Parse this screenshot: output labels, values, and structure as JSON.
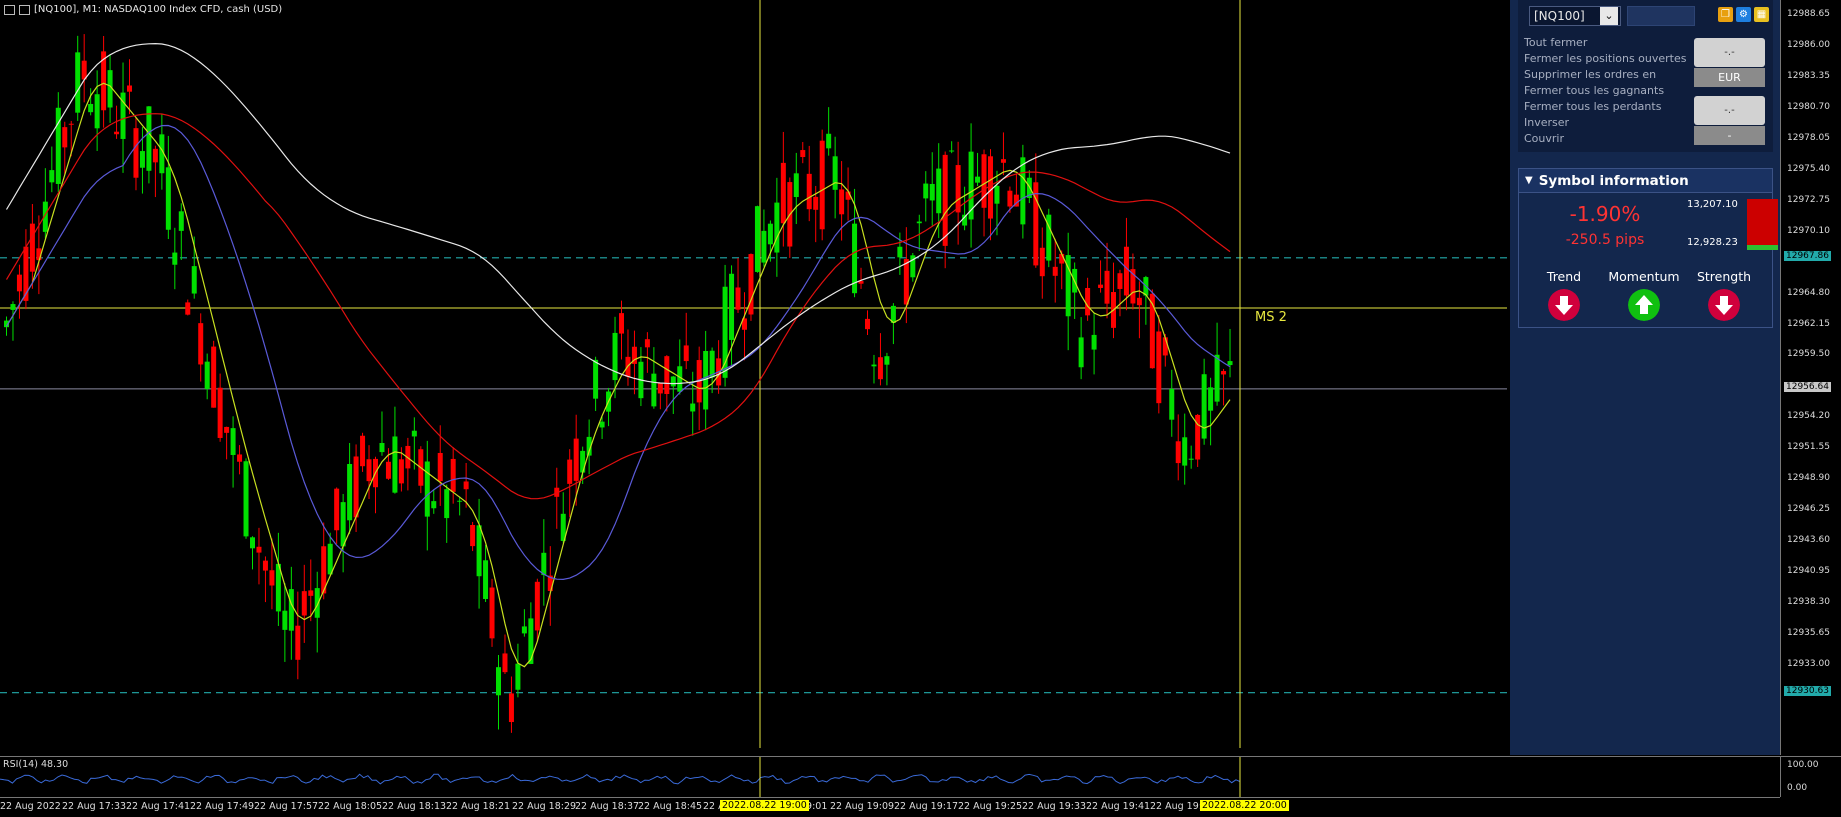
{
  "window": {
    "title": "[NQ100], M1:  NASDAQ100 Index CFD, cash (USD)"
  },
  "chart": {
    "ms_label": "MS 2",
    "price_labels": [
      "12988.65",
      "12986.00",
      "12983.35",
      "12980.70",
      "12978.05",
      "12975.40",
      "12972.75",
      "12970.10",
      "12964.80",
      "12962.15",
      "12959.50",
      "12954.20",
      "12951.55",
      "12948.90",
      "12946.25",
      "12943.60",
      "12940.95",
      "12938.30",
      "12935.65",
      "12933.00"
    ],
    "price_tags": {
      "upper_dash": "12967.86",
      "current": "12956.64",
      "lower_dash": "12930.63"
    },
    "time_labels": [
      "22 Aug 2022",
      "22 Aug 17:33",
      "22 Aug 17:41",
      "22 Aug 17:49",
      "22 Aug 17:57",
      "22 Aug 18:05",
      "22 Aug 18:13",
      "22 Aug 18:21",
      "22 Aug 18:29",
      "22 Aug 18:37",
      "22 Aug 18:45",
      "22 A",
      "19:01",
      "22 Aug 19:09",
      "22 Aug 19:17",
      "22 Aug 19:25",
      "22 Aug 19:33",
      "22 Aug 19:41",
      "22 Aug 19:"
    ],
    "time_tags": [
      "2022.08.22 19:00",
      "2022.08.22 20:00"
    ],
    "rsi": {
      "label": "RSI(14) 48.30",
      "ticks": [
        "100.00",
        "0.00"
      ]
    }
  },
  "colors": {
    "bull": "#00e000",
    "bear": "#ff0000",
    "ma_white": "#e8e8e8",
    "ma_red": "#e01010",
    "ma_blue": "#5a5ad8",
    "ma_yellow": "#c8e020",
    "dash_line": "#22aaaa",
    "vline": "#e8e840",
    "rsi": "#3a6ad8"
  },
  "panel": {
    "symbol": "[NQ100]",
    "menu": [
      "Tout fermer",
      "Fermer les positions ouvertes",
      "Supprimer les ordres en",
      "Fermer tous les gagnants",
      "Fermer tous les perdants",
      "Inverser",
      "Couvrir"
    ],
    "btn1_value": "-.-",
    "btn1_sub": "EUR",
    "btn2_value": "-.-",
    "btn2_sub": "-",
    "tool_icons": [
      "copy-icon",
      "gear-icon",
      "grid-icon"
    ],
    "symbol_info": {
      "header": "Symbol information",
      "percent": "-1.90%",
      "pips": "-250.5 pips",
      "high": "13,207.10",
      "low": "12,928.23",
      "indicators": [
        {
          "label": "Trend",
          "direction": "down",
          "color": "#d0003c"
        },
        {
          "label": "Momentum",
          "direction": "up",
          "color": "#10c010"
        },
        {
          "label": "Strength",
          "direction": "down",
          "color": "#d0003c"
        }
      ]
    }
  }
}
